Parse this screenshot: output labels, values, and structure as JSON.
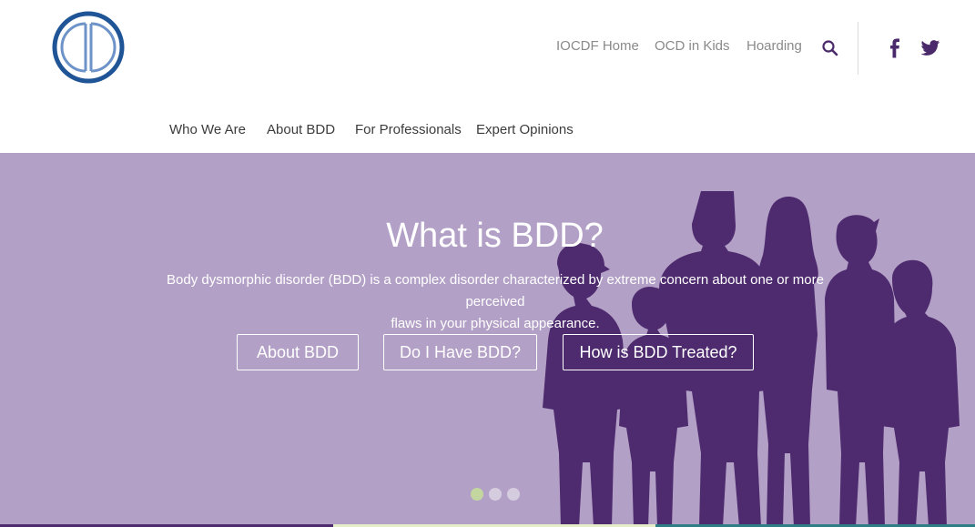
{
  "header": {
    "logo_alt": "CD",
    "top_nav": [
      {
        "label": "IOCDF Home"
      },
      {
        "label": "OCD in Kids"
      },
      {
        "label": "Hoarding"
      }
    ],
    "search_icon": "search-icon",
    "social": [
      {
        "icon": "facebook-icon"
      },
      {
        "icon": "twitter-icon"
      }
    ]
  },
  "main_nav": [
    {
      "label": "Who We Are"
    },
    {
      "label": "About BDD"
    },
    {
      "label": "For Professionals"
    },
    {
      "label": "Expert Opinions"
    }
  ],
  "hero": {
    "title": "What is BDD?",
    "line1": "Body dysmorphic disorder (BDD) is a complex disorder characterized by extreme concern about one or more perceived",
    "line2": "flaws in your physical appearance.",
    "buttons": [
      {
        "label": "About BDD"
      },
      {
        "label": "Do I Have BDD?"
      },
      {
        "label": "How is BDD Treated?"
      }
    ],
    "slide_count": 3,
    "active_slide": 1
  },
  "colors": {
    "hero_bg": "#b3a0c6",
    "silhouette": "#4e2a6e",
    "logo_ring": "#1f5596",
    "logo_inner": "#6e93c8",
    "nav_top": "#8a8a8a",
    "nav_main": "#3c3c3c",
    "icon": "#4a2a6a",
    "dot_active": "#c3d6a0",
    "dot_inactive": "#d6ccdf"
  }
}
